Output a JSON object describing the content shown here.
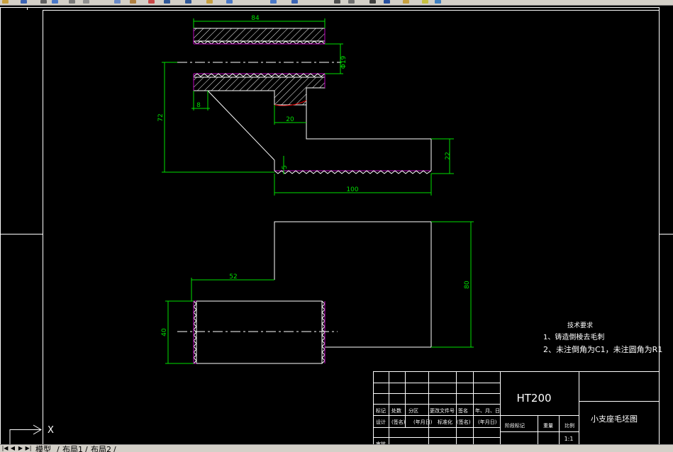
{
  "toolbar": {
    "buttons": [
      {
        "name": "open-icon",
        "color": "#c8a040"
      },
      {
        "name": "save-icon",
        "color": "#3c64b4"
      },
      {
        "name": "print-icon",
        "color": "#606060"
      },
      {
        "name": "preview-icon",
        "color": "#4a78c8"
      },
      {
        "name": "publish-icon",
        "color": "#7a7a7a"
      },
      {
        "name": "cut-icon",
        "color": "#909090"
      },
      {
        "name": "copy-icon",
        "color": "#6a8ac8"
      },
      {
        "name": "paste-icon",
        "color": "#b08040"
      },
      {
        "name": "match-properties-icon",
        "color": "#c84848"
      },
      {
        "name": "undo-icon",
        "color": "#305898"
      },
      {
        "name": "redo-icon",
        "color": "#305898"
      },
      {
        "name": "pan-icon",
        "color": "#c8a040"
      },
      {
        "name": "zoom-realtime-icon",
        "color": "#4a78c8"
      },
      {
        "name": "zoom-window-icon",
        "color": "#4a78c8"
      },
      {
        "name": "properties-icon",
        "color": "#3c64b4"
      },
      {
        "name": "design-center-icon",
        "color": "#505050"
      },
      {
        "name": "tool-palettes-icon",
        "color": "#707070"
      },
      {
        "name": "calculator-icon",
        "color": "#404040"
      },
      {
        "name": "help-icon",
        "color": "#2850a0"
      },
      {
        "name": "layer-icon",
        "color": "#c8a040"
      },
      {
        "name": "layer-state-icon",
        "color": "#c8c040"
      },
      {
        "name": "layer-previous-icon",
        "color": "#4080c0"
      }
    ]
  },
  "drawing": {
    "dims": {
      "d84": "84",
      "d19": "Φ19",
      "d72": "72",
      "d8": "8",
      "d20": "20",
      "d5": "5",
      "d22": "22",
      "d100": "100",
      "d80": "80",
      "d52": "52",
      "d40": "40"
    },
    "notes": {
      "title": "技术要求",
      "line1": "1、铸造倒棱去毛刺",
      "line2": "2、未注倒角为C1，未注圆角为R1"
    },
    "title_block": {
      "material": "HT200",
      "part_name": "小支座毛坯图",
      "scale": "1:1",
      "headers": {
        "mark": "标记",
        "count": "处数",
        "zone": "分区",
        "doc_no": "更改文件号",
        "sign": "签名",
        "date": "年、月、日",
        "design": "设计",
        "sign2": "(签名)",
        "date2": "(年月日)",
        "std": "标准化",
        "sign3": "(签名)",
        "date3": "(年月日)",
        "stage": "阶段标记",
        "weight": "重量",
        "ratio": "比例",
        "review": "审核"
      }
    },
    "ucs": {
      "x": "X"
    }
  },
  "tabs": {
    "model": "模型",
    "layout1": "布局1",
    "layout2": "布局2"
  }
}
